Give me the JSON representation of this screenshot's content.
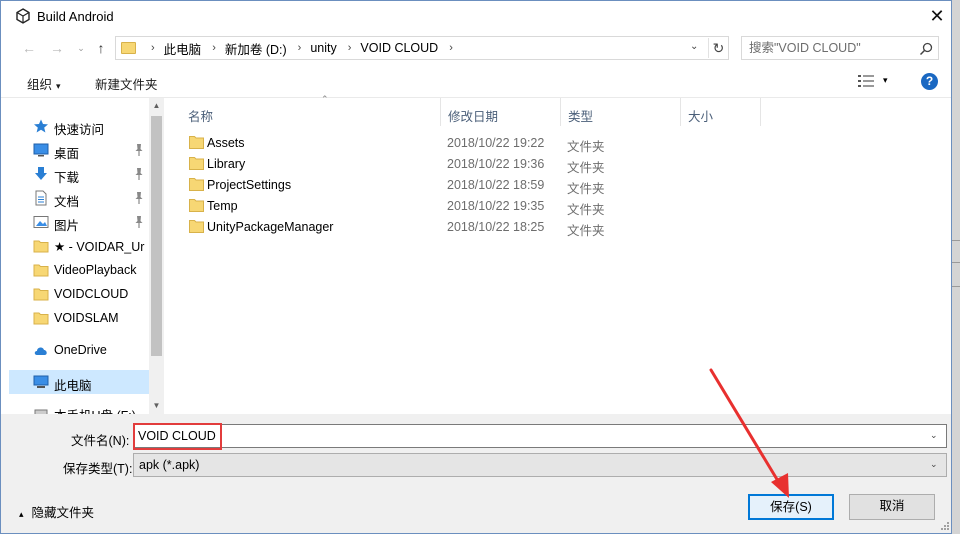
{
  "window": {
    "title": "Build Android",
    "close_glyph": "✕"
  },
  "nav": {
    "back_glyph": "←",
    "forward_glyph": "→",
    "recent_glyph": "⌄",
    "up_glyph": "↑",
    "breadcrumbs": [
      "此电脑",
      "新加卷 (D:)",
      "unity",
      "VOID CLOUD"
    ],
    "separator": "›",
    "dropdown_glyph": "⌄",
    "refresh_glyph": "↻"
  },
  "search": {
    "placeholder": "搜索\"VOID CLOUD\""
  },
  "toolbar": {
    "organize_label": "组织",
    "organize_caret": "▾",
    "new_folder_label": "新建文件夹",
    "view_caret": "▾",
    "help_label": "?"
  },
  "sidebar": {
    "items": [
      {
        "label": "快速访问",
        "icon": "star-icon",
        "pinned": false
      },
      {
        "label": "桌面",
        "icon": "desktop-icon",
        "pinned": true
      },
      {
        "label": "下载",
        "icon": "download-icon",
        "pinned": true
      },
      {
        "label": "文档",
        "icon": "document-icon",
        "pinned": true
      },
      {
        "label": "图片",
        "icon": "picture-icon",
        "pinned": true
      },
      {
        "label": "★ - VOIDAR_Ur",
        "icon": "folder-icon",
        "pinned": false
      },
      {
        "label": "VideoPlayback",
        "icon": "folder-icon",
        "pinned": false
      },
      {
        "label": "VOIDCLOUD",
        "icon": "folder-icon",
        "pinned": false
      },
      {
        "label": "VOIDSLAM",
        "icon": "folder-icon",
        "pinned": false
      },
      {
        "label": "OneDrive",
        "icon": "cloud-icon",
        "pinned": false
      },
      {
        "label": "此电脑",
        "icon": "computer-icon",
        "pinned": false,
        "selected": true
      },
      {
        "label": "本手机U盘 (F:)",
        "icon": "drive-icon",
        "pinned": false
      }
    ],
    "pin_glyph": "📌",
    "scroll_up_glyph": "▲",
    "scroll_down_glyph": "▼"
  },
  "filelist": {
    "columns": [
      "名称",
      "修改日期",
      "类型",
      "大小"
    ],
    "sort_glyph": "⌃",
    "rows": [
      {
        "name": "Assets",
        "date": "2018/10/22 19:22",
        "type": "文件夹"
      },
      {
        "name": "Library",
        "date": "2018/10/22 19:36",
        "type": "文件夹"
      },
      {
        "name": "ProjectSettings",
        "date": "2018/10/22 18:59",
        "type": "文件夹"
      },
      {
        "name": "Temp",
        "date": "2018/10/22 19:35",
        "type": "文件夹"
      },
      {
        "name": "UnityPackageManager",
        "date": "2018/10/22 18:25",
        "type": "文件夹"
      }
    ]
  },
  "form": {
    "filename_label": "文件名(N):",
    "filename_value": "VOID CLOUD",
    "filetype_label": "保存类型(T):",
    "filetype_value": "apk (*.apk)",
    "dropdown_glyph": "⌄"
  },
  "footer": {
    "hide_folders_label": "隐藏文件夹",
    "hide_caret": "▴",
    "save_label": "保存(S)",
    "cancel_label": "取消"
  },
  "colors": {
    "accent": "#0078d7",
    "selection": "#cde8ff",
    "annotation_red": "#e23c3c",
    "folder": "#f7d774"
  }
}
